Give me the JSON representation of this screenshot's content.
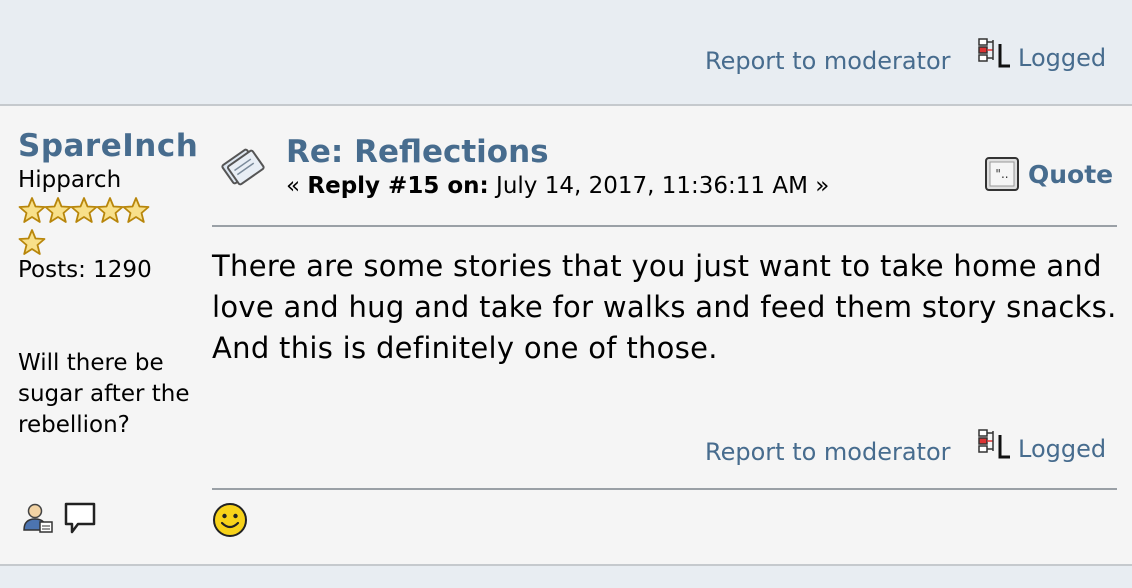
{
  "top": {
    "report_label": "Report to moderator",
    "logged_label": "Logged"
  },
  "poster": {
    "name": "SpareInch",
    "rank": "Hipparch",
    "star_count": 6,
    "posts": "Posts: 1290",
    "signature": "Will there be sugar after the rebellion?"
  },
  "post": {
    "subject": "Re: Reflections",
    "reply_prefix": "« ",
    "reply_label": "Reply #15 on:",
    "reply_date": " July 14, 2017, 11:36:11 AM »",
    "quote_label": "Quote",
    "body": "There are some stories that you just want to take home and love and hug and take for walks and feed them story snacks. And this is definitely one of those.",
    "report_label": "Report to moderator",
    "logged_label": "Logged"
  },
  "colors": {
    "link": "#476c8e",
    "band": "#e8edf2",
    "post_bg": "#f5f5f5"
  }
}
